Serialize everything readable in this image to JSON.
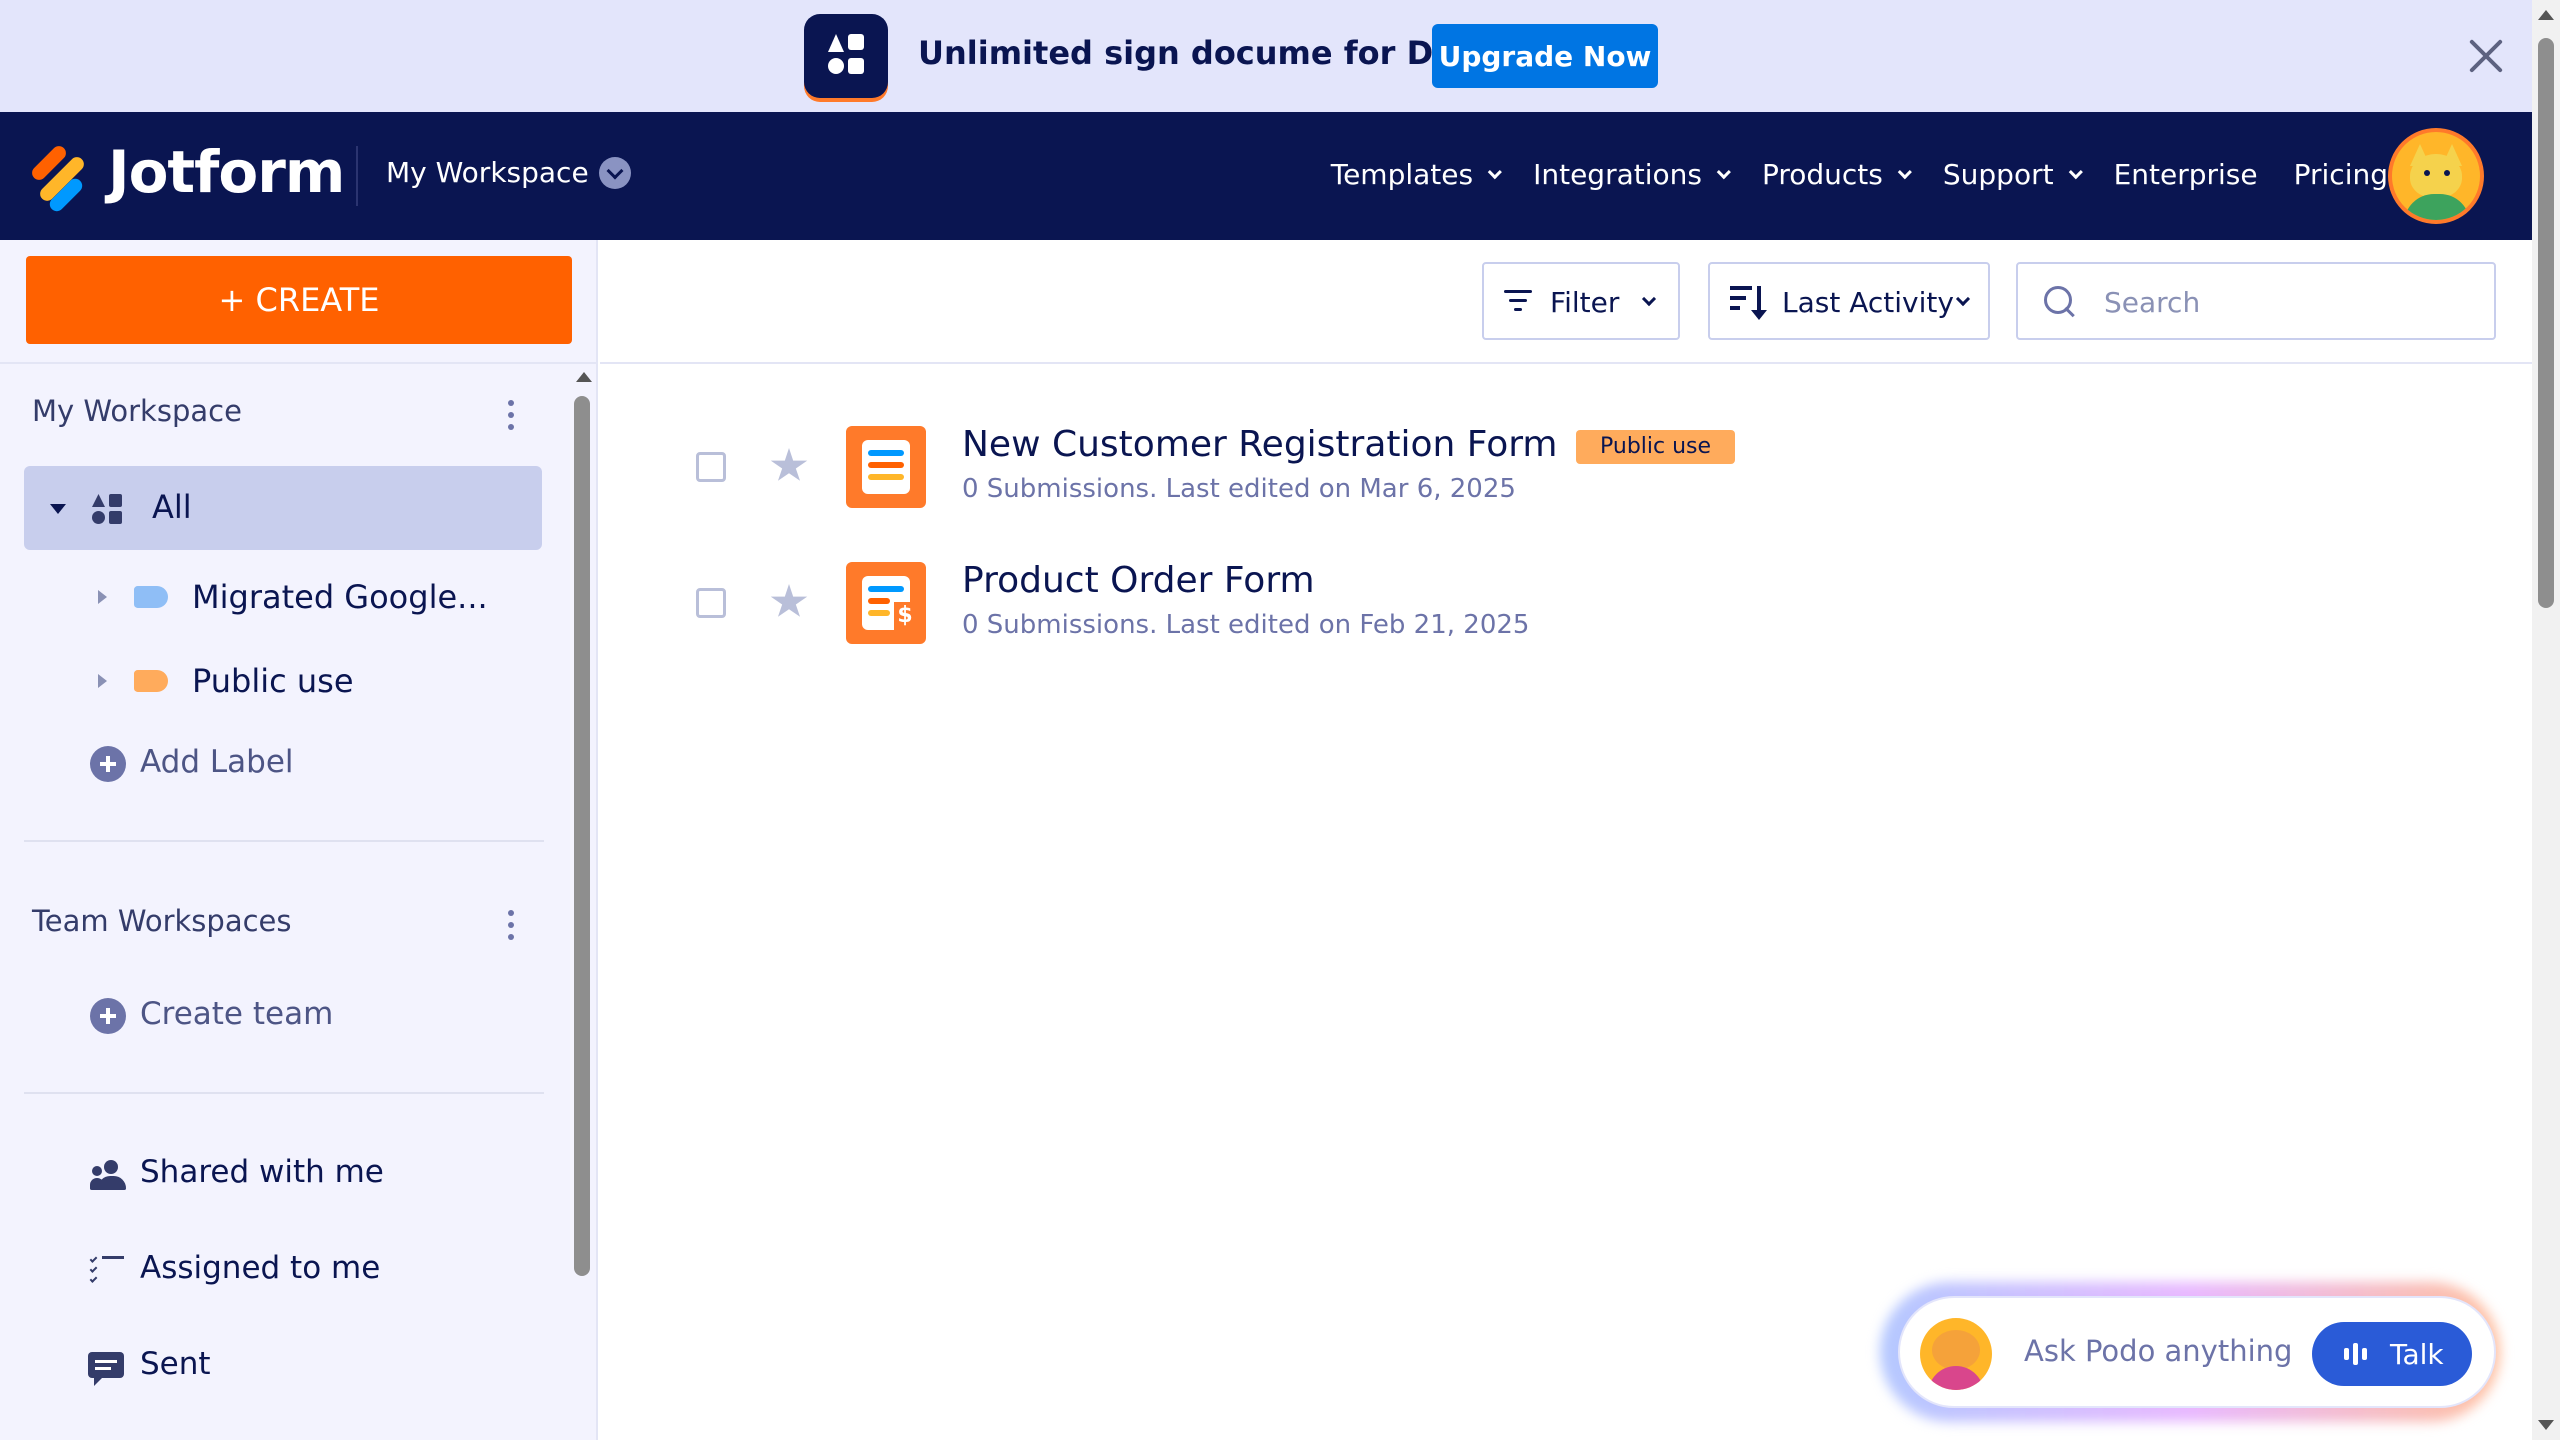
{
  "banner": {
    "text": "Unlimited sign docume for Demo",
    "upgrade_label": "Upgrade Now"
  },
  "nav": {
    "logo": "Jotform",
    "workspace": "My Workspace",
    "links": [
      {
        "label": "Templates",
        "has_caret": true
      },
      {
        "label": "Integrations",
        "has_caret": true
      },
      {
        "label": "Products",
        "has_caret": true
      },
      {
        "label": "Support",
        "has_caret": true
      },
      {
        "label": "Enterprise",
        "has_caret": false
      },
      {
        "label": "Pricing",
        "has_caret": false
      }
    ]
  },
  "sidebar": {
    "create_label": "+ CREATE",
    "my_workspace_title": "My Workspace",
    "all_label": "All",
    "labels": [
      {
        "name": "Migrated Google...",
        "color": "#8fbef6"
      },
      {
        "name": "Public use",
        "color": "#ffab5c"
      }
    ],
    "add_label": "Add Label",
    "team_title": "Team Workspaces",
    "create_team": "Create team",
    "shared": "Shared with me",
    "assigned": "Assigned to me",
    "sent": "Sent"
  },
  "toolbar": {
    "filter_label": "Filter",
    "sort_label": "Last Activity",
    "search_placeholder": "Search"
  },
  "forms": [
    {
      "title": "New Customer Registration Form",
      "badge": "Public use",
      "meta": "0 Submissions. Last edited on Mar 6, 2025",
      "icon": "form-icon"
    },
    {
      "title": "Product Order Form",
      "badge": "",
      "meta": "0 Submissions. Last edited on Feb 21, 2025",
      "icon": "payment-form-icon"
    }
  ],
  "podo": {
    "placeholder": "Ask Podo anything",
    "talk_label": "Talk"
  },
  "colors": {
    "navy": "#0a1551",
    "orange": "#ff6100",
    "blue": "#0075e3",
    "sidebar_bg": "#f3f3fe",
    "selected_bg": "#c8ceed"
  }
}
